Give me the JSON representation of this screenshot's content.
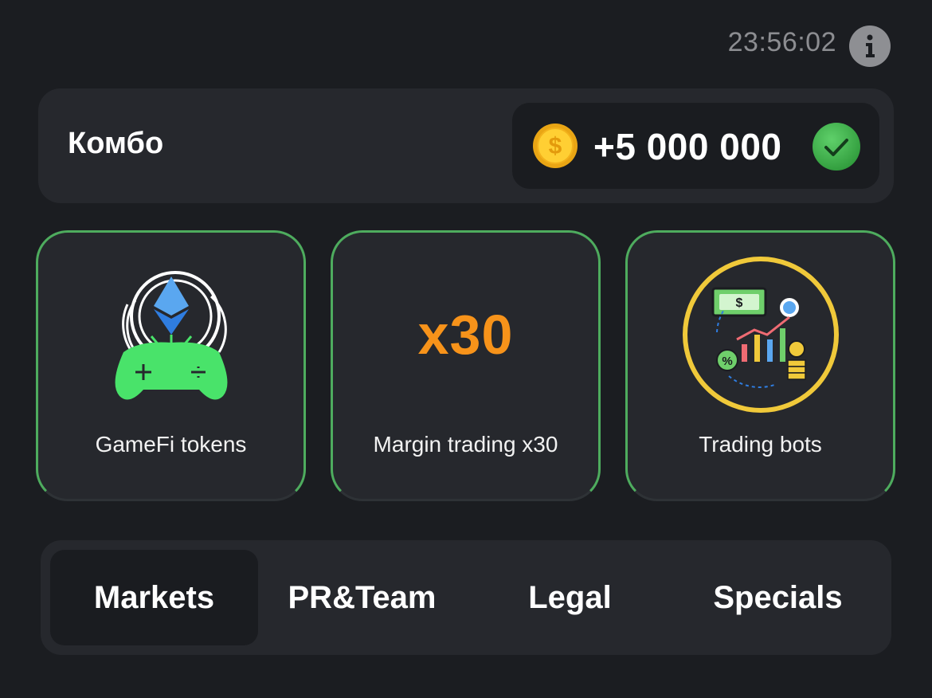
{
  "header": {
    "timer": "23:56:02",
    "info_icon": "info-icon"
  },
  "combo": {
    "title": "Комбо",
    "reward": "+5 000 000",
    "coin_icon": "coin-icon",
    "status_icon": "check-icon",
    "accent_color": "#4eac5e"
  },
  "cards": [
    {
      "label": "GameFi tokens",
      "icon": "gamepad-ethereum-icon"
    },
    {
      "label": "Margin trading x30",
      "art_text": "x30",
      "art_color": "#f7931a"
    },
    {
      "label": "Trading bots",
      "icon": "trading-bot-icon"
    }
  ],
  "tabs": [
    {
      "label": "Markets",
      "active": true
    },
    {
      "label": "PR&Team",
      "active": false
    },
    {
      "label": "Legal",
      "active": false
    },
    {
      "label": "Specials",
      "active": false
    }
  ]
}
